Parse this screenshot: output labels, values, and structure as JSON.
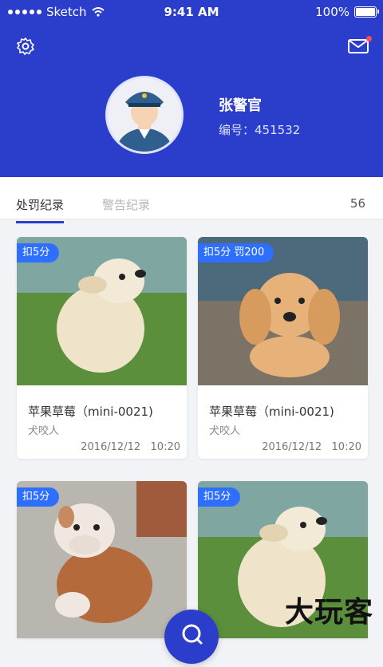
{
  "status_bar": {
    "carrier": "Sketch",
    "time": "9:41 AM",
    "battery": "100%"
  },
  "header": {
    "user_name": "张警官",
    "user_id": "编号：451532",
    "colors": {
      "primary": "#2b3ecb",
      "badge": "#2f6fff",
      "notification_dot": "#ff4d4f"
    }
  },
  "tabs": {
    "active": "处罚纪录",
    "inactive": "警告纪录",
    "count": "56"
  },
  "records": [
    {
      "badge": "扣5分",
      "title": "苹果草莓（mini-0021)",
      "subtitle": "犬咬人",
      "date": "2016/12/12",
      "time": "10:20"
    },
    {
      "badge": "扣5分  罚200",
      "title": "苹果草莓（mini-0021)",
      "subtitle": "犬咬人",
      "date": "2016/12/12",
      "time": "10:20"
    },
    {
      "badge": "扣5分"
    },
    {
      "badge": "扣5分"
    }
  ],
  "watermark": "大玩客"
}
